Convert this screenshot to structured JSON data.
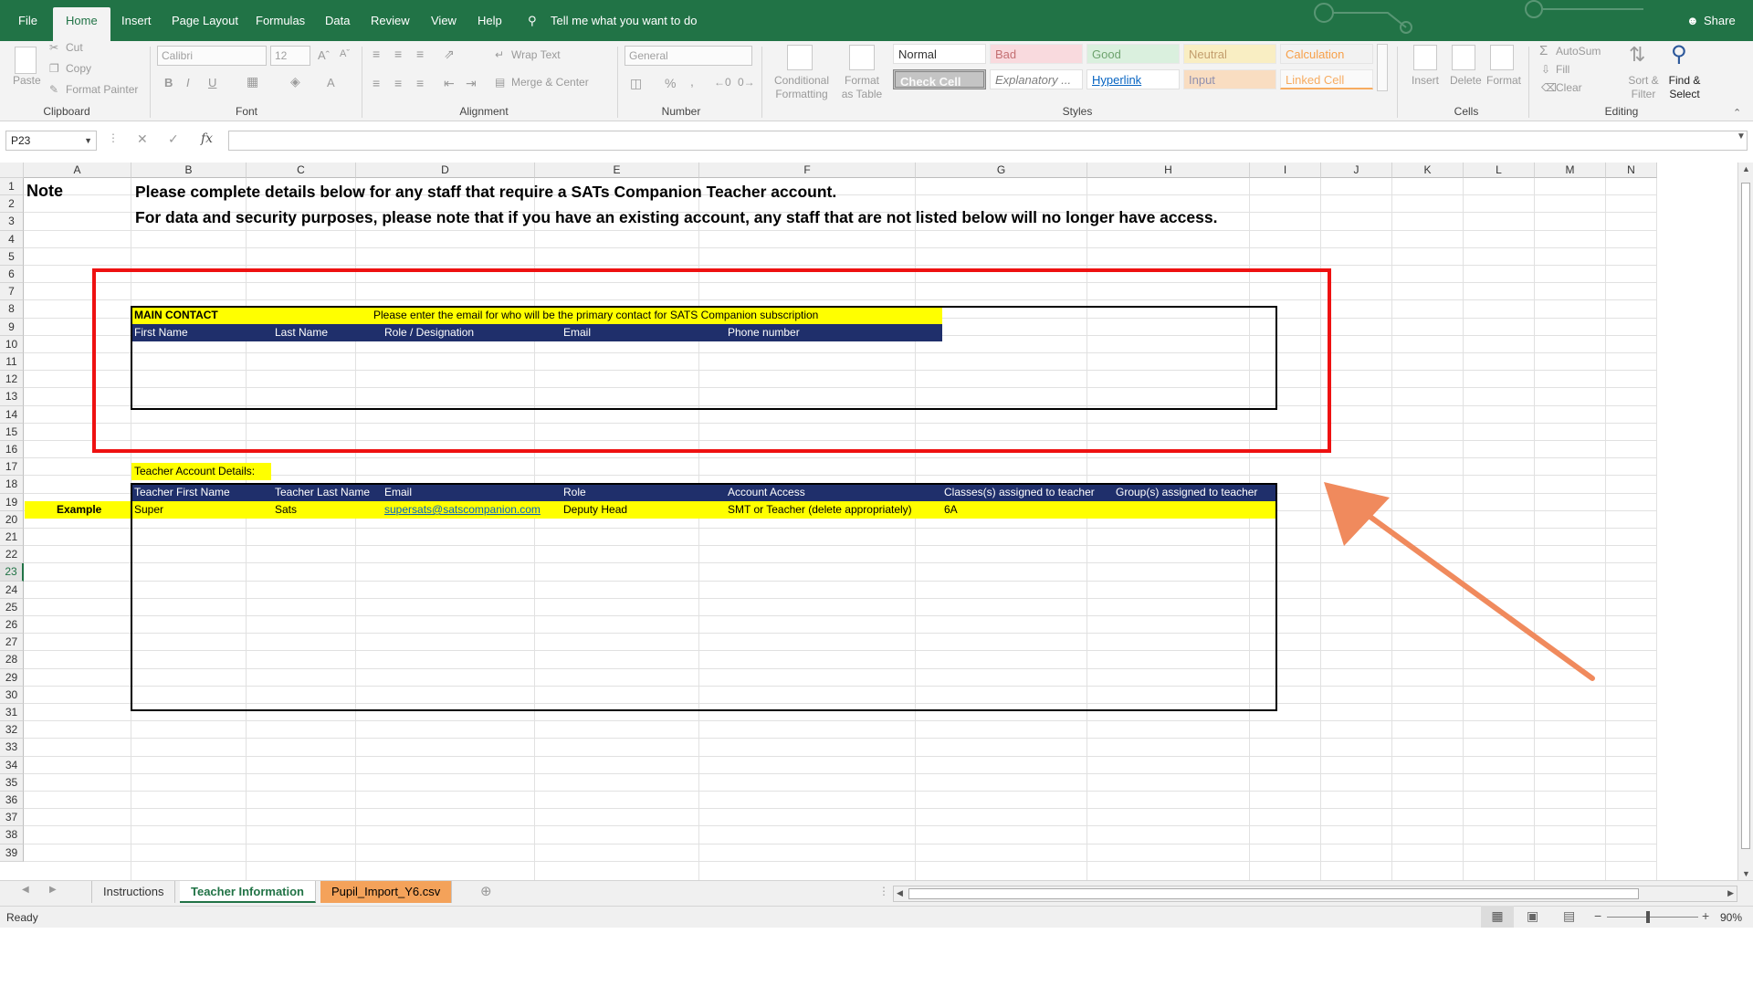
{
  "ribbon_tabs": [
    "File",
    "Home",
    "Insert",
    "Page Layout",
    "Formulas",
    "Data",
    "Review",
    "View",
    "Help"
  ],
  "active_tab": "Home",
  "tell_me": "Tell me what you want to do",
  "share": "Share",
  "clipboard": {
    "paste": "Paste",
    "cut": "Cut",
    "copy": "Copy",
    "format_painter": "Format Painter",
    "label": "Clipboard"
  },
  "font": {
    "name": "Calibri",
    "size": "12",
    "label": "Font",
    "bold": "B",
    "italic": "I",
    "underline": "U",
    "color_letter": "A"
  },
  "alignment": {
    "wrap": "Wrap Text",
    "merge": "Merge & Center",
    "label": "Alignment"
  },
  "number": {
    "format": "General",
    "label": "Number",
    "percent": "%",
    "comma": ","
  },
  "styles": {
    "conditional": "Conditional Formatting",
    "format_as": "Format as Table",
    "label": "Styles",
    "cells": [
      "Normal",
      "Bad",
      "Good",
      "Neutral",
      "Calculation",
      "Check Cell",
      "Explanatory ...",
      "Hyperlink",
      "Input",
      "Linked Cell"
    ]
  },
  "cells_group": {
    "insert": "Insert",
    "delete": "Delete",
    "format": "Format",
    "label": "Cells"
  },
  "editing": {
    "autosum": "AutoSum",
    "fill": "Fill",
    "clear": "Clear",
    "sort": "Sort & Filter",
    "find": "Find & Select",
    "label": "Editing"
  },
  "name_box": "P23",
  "fx": "fx",
  "columns": [
    "A",
    "B",
    "C",
    "D",
    "E",
    "F",
    "G",
    "H",
    "I",
    "J",
    "K",
    "L",
    "M",
    "N"
  ],
  "rows": [
    "1",
    "2",
    "3",
    "4",
    "5",
    "6",
    "7",
    "8",
    "9",
    "10",
    "11",
    "12",
    "13",
    "14",
    "15",
    "16",
    "17",
    "18",
    "19",
    "20",
    "21",
    "22",
    "23",
    "24",
    "25",
    "26",
    "27",
    "28",
    "29",
    "30",
    "31",
    "32",
    "33",
    "34",
    "35",
    "36",
    "37",
    "38",
    "39"
  ],
  "sheet": {
    "note_label": "Note",
    "line1": "Please complete details below for any staff that require a SATs Companion Teacher account.",
    "line2": "For data and security purposes, please note that if you have an existing account, any staff that are not listed below will no longer have access.",
    "main_contact_label": "MAIN CONTACT",
    "main_contact_note": "Please enter the email for who will be the primary contact for SATS Companion subscription",
    "main_headers": [
      "First Name",
      "Last Name",
      "Role / Designation",
      "Email",
      "Phone number"
    ],
    "teacher_section": "Teacher Account Details:",
    "teacher_headers": [
      "Teacher First Name",
      "Teacher Last Name",
      "Email",
      "Role",
      "Account Access",
      "Classes(s) assigned to teacher",
      "Group(s) assigned to teacher"
    ],
    "example_label": "Example",
    "example_row": [
      "Super",
      "Sats",
      "supersats@satscompanion.com",
      "Deputy Head",
      "SMT or Teacher  (delete appropriately)",
      "6A",
      ""
    ]
  },
  "sheet_tabs": [
    "Instructions",
    "Teacher Information",
    "Pupil_Import_Y6.csv"
  ],
  "active_sheet": "Teacher Information",
  "status": {
    "ready": "Ready",
    "zoom": "90%"
  },
  "colors": {
    "excel_green": "#217346",
    "navy_header": "#1f2f6b",
    "yellow": "#ffff00",
    "red_box": "#ee1111",
    "arrow": "#f08a5d",
    "orange_tab": "#f4a25a"
  }
}
